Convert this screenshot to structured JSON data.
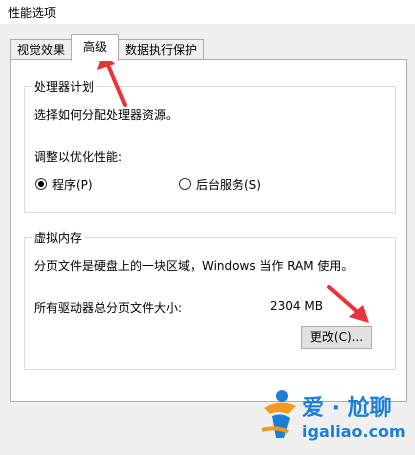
{
  "window": {
    "title": "性能选项"
  },
  "tabs": [
    {
      "label": "视觉效果"
    },
    {
      "label": "高级"
    },
    {
      "label": "数据执行保护"
    }
  ],
  "processor": {
    "group_title": "处理器计划",
    "description": "选择如何分配处理器资源。",
    "adjust_label": "调整以优化性能:",
    "option_programs": "程序(P)",
    "option_services": "后台服务(S)",
    "selected": "programs"
  },
  "virtual_memory": {
    "group_title": "虚拟内存",
    "description": "分页文件是硬盘上的一块区域，Windows 当作 RAM 使用。",
    "total_label": "所有驱动器总分页文件大小:",
    "total_value": "2304 MB",
    "change_button": "更改(C)..."
  },
  "watermark": {
    "brand_cn": "爱 · 尬聊",
    "domain": "igaliao.com"
  },
  "colors": {
    "annotation_arrow": "#e8333a",
    "watermark_blue": "#1c7fd6",
    "watermark_orange": "#f39a1e"
  }
}
